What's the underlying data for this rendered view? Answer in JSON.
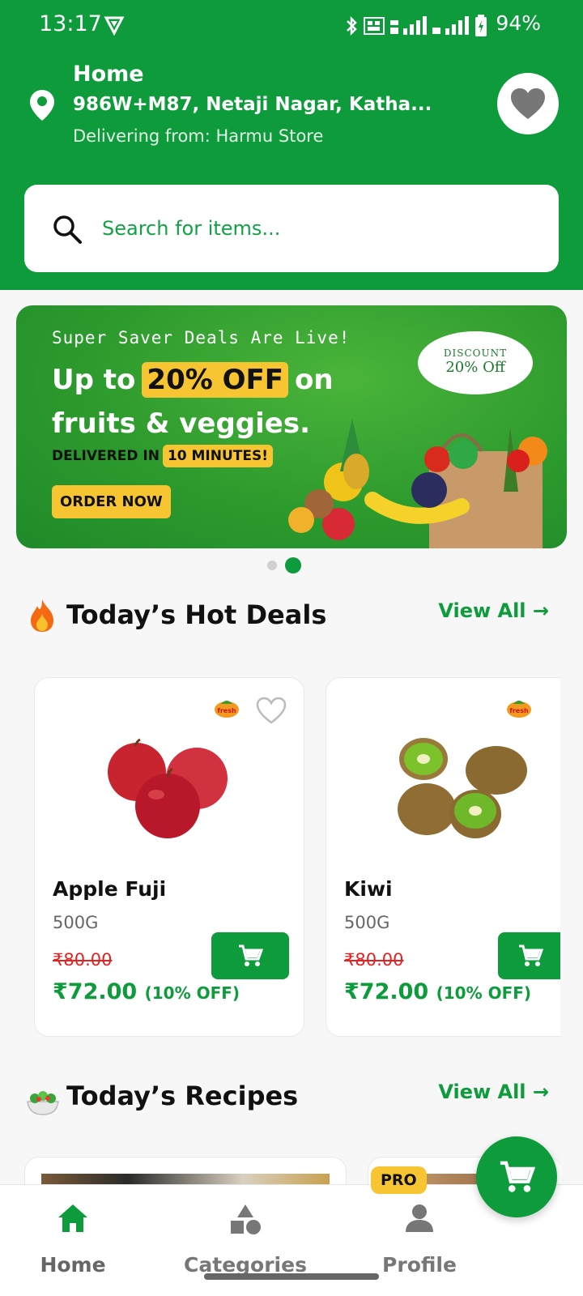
{
  "status": {
    "time": "13:17",
    "battery": "94%"
  },
  "header": {
    "title": "Home",
    "address": "986W+M87, Netaji Nagar, Katha...",
    "store": "Delivering from: Harmu Store"
  },
  "search": {
    "placeholder": "Search for items..."
  },
  "banner": {
    "subtitle": "Super Saver Deals Are Live!",
    "line1_a": "Up to",
    "line1_highlight": "20% OFF",
    "line1_b": "on",
    "line2": "fruits & veggies.",
    "line3_a": "DELIVERED IN",
    "line3_highlight": "10 MINUTES!",
    "button": "ORDER NOW",
    "discount_label": "DISCOUNT",
    "discount_value": "20% Off"
  },
  "carousel": {
    "count": 2,
    "active": 1
  },
  "hot_deals": {
    "title": "Today’s Hot Deals",
    "view_all": "View All →",
    "products": [
      {
        "name": "Apple Fuji",
        "qty": "500G",
        "old_price": "₹80.00",
        "new_price": "₹72.00",
        "off": "(10% OFF)"
      },
      {
        "name": "Kiwi",
        "qty": "500G",
        "old_price": "₹80.00",
        "new_price": "₹72.00",
        "off": "(10% OFF)"
      }
    ]
  },
  "recipes": {
    "title": "Today’s Recipes",
    "view_all": "View All →",
    "badge": "PRO"
  },
  "nav": {
    "items": [
      {
        "label": "Home"
      },
      {
        "label": "Categories"
      },
      {
        "label": "Profile"
      }
    ]
  },
  "colors": {
    "brand_green": "#0d9b3b",
    "accent_yellow": "#f7c531",
    "price_red": "#e42222"
  }
}
